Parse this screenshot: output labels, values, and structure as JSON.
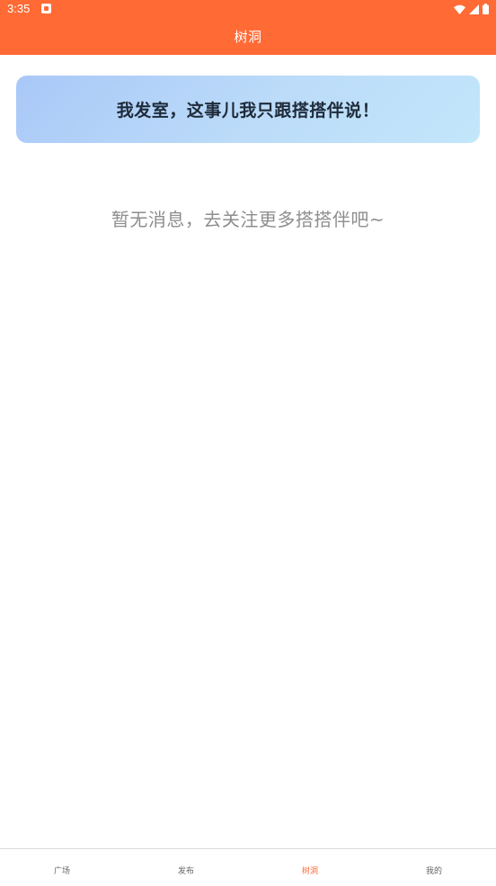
{
  "status_bar": {
    "time": "3:35",
    "notification_icon": "notification-app-icon",
    "icons": [
      "wifi-icon",
      "cell-signal-icon",
      "battery-icon"
    ]
  },
  "app_bar": {
    "title": "树洞"
  },
  "banner": {
    "text": "我发室，这事儿我只跟搭搭伴说！"
  },
  "empty_state": {
    "message": "暂无消息，去关注更多搭搭伴吧~"
  },
  "bottom_nav": {
    "items": [
      {
        "label": "广场",
        "active": false
      },
      {
        "label": "发布",
        "active": false
      },
      {
        "label": "树洞",
        "active": true
      },
      {
        "label": "我的",
        "active": false
      }
    ]
  },
  "colors": {
    "accent": "#ff6a35",
    "banner_gradient_start": "#a9c8f8",
    "banner_gradient_end": "#c2e6fa",
    "empty_text": "#8e8e8e"
  }
}
